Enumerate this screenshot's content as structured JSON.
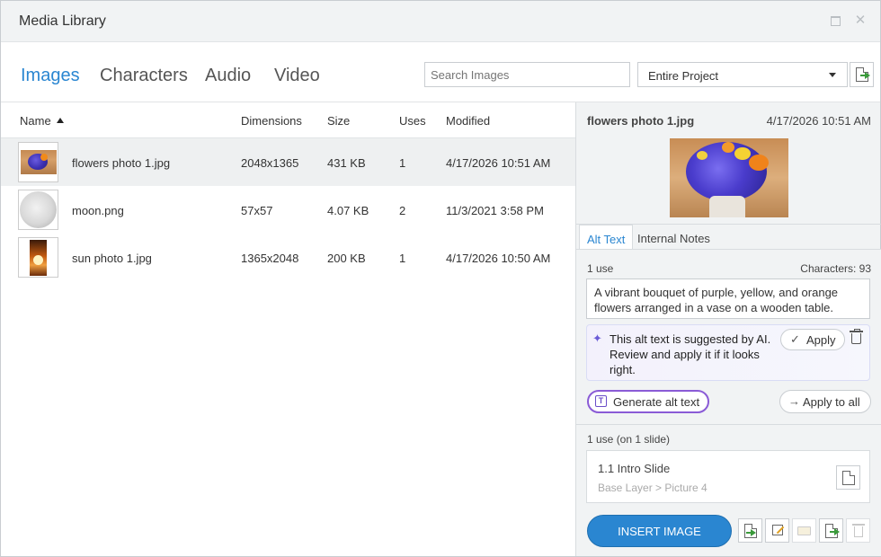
{
  "window": {
    "title": "Media Library"
  },
  "tabs": [
    {
      "label": "Images",
      "active": true
    },
    {
      "label": "Characters",
      "active": false
    },
    {
      "label": "Audio",
      "active": false
    },
    {
      "label": "Video",
      "active": false
    }
  ],
  "search": {
    "placeholder": "Search Images",
    "value": ""
  },
  "scope": {
    "selected": "Entire Project"
  },
  "list": {
    "columns": {
      "name": "Name",
      "dimensions": "Dimensions",
      "size": "Size",
      "uses": "Uses",
      "modified": "Modified"
    },
    "sort": {
      "column": "name",
      "direction": "ascending"
    },
    "rows": [
      {
        "name": "flowers photo 1.jpg",
        "dimensions": "2048x1365",
        "size": "431 KB",
        "uses": "1",
        "modified": "4/17/2026 10:51 AM",
        "selected": true
      },
      {
        "name": "moon.png",
        "dimensions": "57x57",
        "size": "4.07 KB",
        "uses": "2",
        "modified": "11/3/2021 3:58 PM",
        "selected": false
      },
      {
        "name": "sun photo 1.jpg",
        "dimensions": "1365x2048",
        "size": "200 KB",
        "uses": "1",
        "modified": "4/17/2026 10:50 AM",
        "selected": false
      }
    ]
  },
  "details": {
    "title": "flowers photo 1.jpg",
    "date": "4/17/2026 10:51 AM",
    "tabs": {
      "alt_text": "Alt Text",
      "notes": "Internal Notes"
    },
    "uses_label": "1 use",
    "characters_label": "Characters: 93",
    "alt_text": "A vibrant bouquet of purple, yellow, and orange flowers arranged in a vase on a wooden table.",
    "ai_message": "This alt text is suggested by AI. Review and apply it if it looks right.",
    "apply_label": "Apply",
    "generate_label": "Generate alt text",
    "apply_all_label": "Apply to all",
    "usage_title": "1 use (on 1 slide)",
    "slide": {
      "name": "1.1 Intro Slide",
      "path": "Base Layer > Picture 4"
    },
    "insert_label": "INSERT IMAGE"
  },
  "colors": {
    "accent": "#2a86d1",
    "selected_row": "#eef0f1",
    "panel_bg": "#f1f3f4",
    "ai_border": "#8a5bd6"
  }
}
